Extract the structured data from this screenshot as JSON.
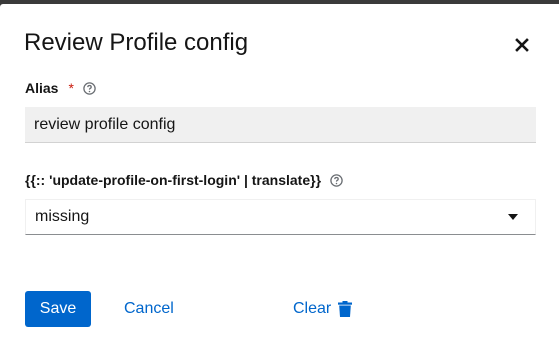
{
  "modal": {
    "title": "Review Profile config",
    "close_icon": "close-icon"
  },
  "form": {
    "alias": {
      "label": "Alias",
      "required_marker": "*",
      "help_icon": "help-icon",
      "value": "review profile config"
    },
    "update_profile": {
      "label": "{{:: 'update-profile-on-first-login' | translate}}",
      "help_icon": "help-icon",
      "selected": "missing",
      "caret_icon": "caret-down-icon"
    }
  },
  "actions": {
    "save_label": "Save",
    "cancel_label": "Cancel",
    "clear_label": "Clear",
    "clear_icon": "trash-icon"
  },
  "colors": {
    "primary": "#0066cc",
    "required": "#c9190b",
    "input_bg": "#f0f0f0",
    "text": "#151515"
  }
}
